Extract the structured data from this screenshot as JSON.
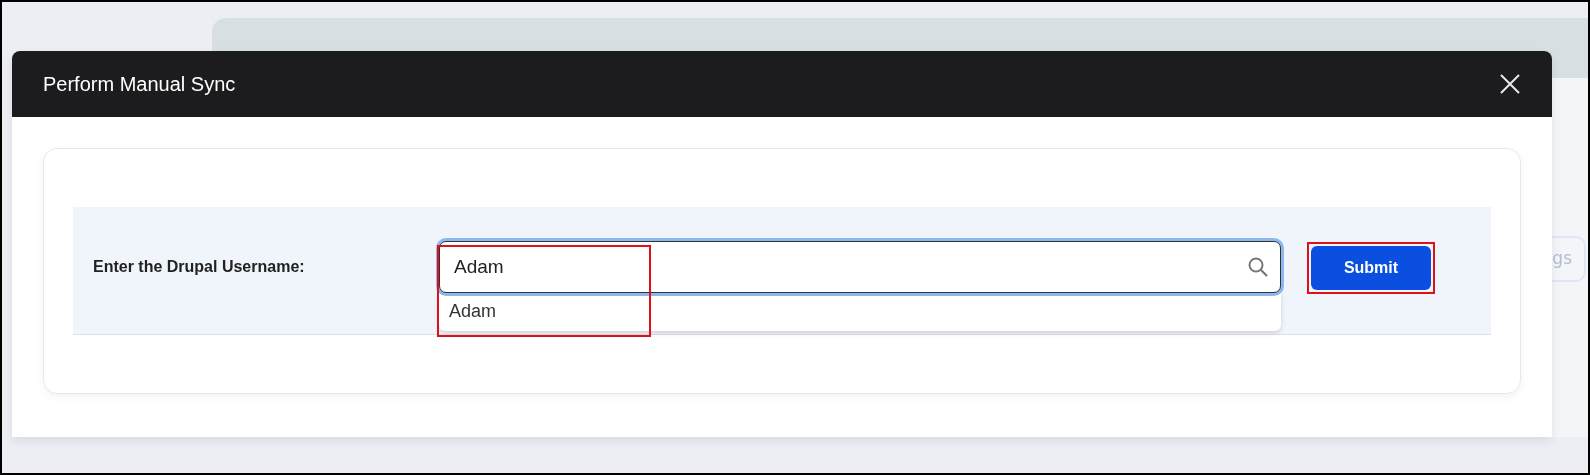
{
  "background": {
    "button_label": "gs"
  },
  "dialog": {
    "title": "Perform Manual Sync",
    "form": {
      "label": "Enter the Drupal Username:",
      "username": {
        "value": "Adam",
        "focused": true
      },
      "suggestions": [
        {
          "text": "Adam"
        }
      ],
      "submit": "Submit"
    }
  }
}
